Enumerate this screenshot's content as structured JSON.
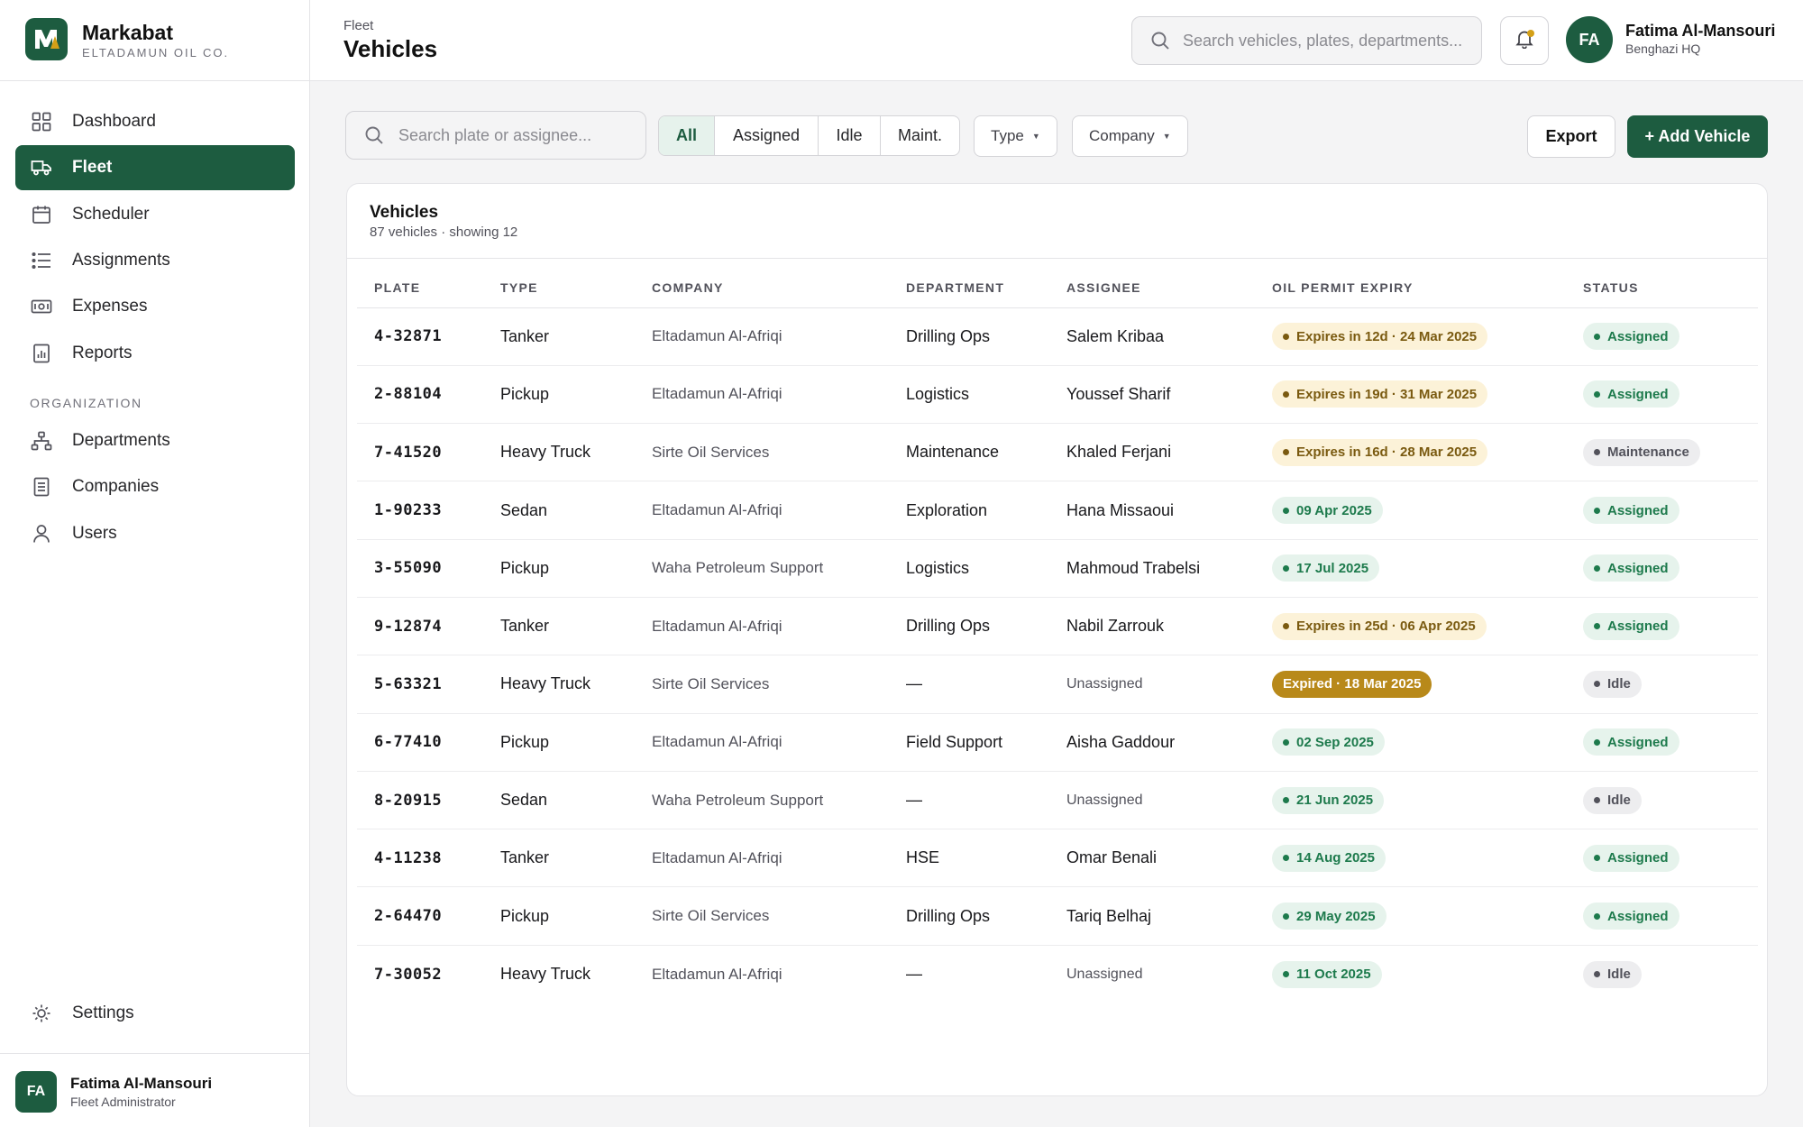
{
  "app": {
    "name": "Markabat",
    "subtitle": "ELTADAMUN OIL CO.",
    "logo_letter": "M"
  },
  "sidebar": {
    "items": [
      {
        "label": "Dashboard",
        "icon": "dashboard-grid-icon"
      },
      {
        "label": "Fleet",
        "icon": "truck-icon",
        "active": true
      },
      {
        "label": "Scheduler",
        "icon": "calendar-icon"
      },
      {
        "label": "Assignments",
        "icon": "list-icon"
      },
      {
        "label": "Expenses",
        "icon": "banknote-icon"
      },
      {
        "label": "Reports",
        "icon": "report-chart-icon"
      }
    ],
    "section_label": "ORGANIZATION",
    "org_items": [
      {
        "label": "Departments",
        "icon": "org-chart-icon"
      },
      {
        "label": "Companies",
        "icon": "document-icon"
      },
      {
        "label": "Users",
        "icon": "user-icon"
      }
    ],
    "settings_label": "Settings",
    "user": {
      "initials": "FA",
      "name": "Fatima Al-Mansouri",
      "role": "Fleet Administrator"
    }
  },
  "header": {
    "breadcrumb": "Fleet",
    "title": "Vehicles",
    "search_placeholder": "Search vehicles, plates, departments...",
    "user": {
      "initials": "FA",
      "name": "Fatima Al-Mansouri",
      "location": "Benghazi HQ"
    }
  },
  "toolbar": {
    "search_placeholder": "Search plate or assignee...",
    "filters": [
      {
        "label": "All",
        "active": true
      },
      {
        "label": "Assigned"
      },
      {
        "label": "Idle"
      },
      {
        "label": "Maint."
      }
    ],
    "type_dropdown": "Type",
    "company_dropdown": "Company",
    "export_label": "Export",
    "add_label": "+ Add Vehicle"
  },
  "table": {
    "title": "Vehicles",
    "subtitle": "87 vehicles · showing 12",
    "columns": [
      "PLATE",
      "TYPE",
      "COMPANY",
      "DEPARTMENT",
      "ASSIGNEE",
      "OIL PERMIT EXPIRY",
      "STATUS"
    ],
    "rows": [
      {
        "plate": "4-32871",
        "type": "Tanker",
        "company": "Eltadamun Al-Afriqi",
        "department": "Drilling Ops",
        "assignee": "Salem Kribaa",
        "expiry": "Expires in 12d · 24 Mar 2025",
        "expiry_state": "warn",
        "status": "Assigned"
      },
      {
        "plate": "2-88104",
        "type": "Pickup",
        "company": "Eltadamun Al-Afriqi",
        "department": "Logistics",
        "assignee": "Youssef Sharif",
        "expiry": "Expires in 19d · 31 Mar 2025",
        "expiry_state": "warn",
        "status": "Assigned"
      },
      {
        "plate": "7-41520",
        "type": "Heavy Truck",
        "company": "Sirte Oil Services",
        "department": "Maintenance",
        "assignee": "Khaled Ferjani",
        "expiry": "Expires in 16d · 28 Mar 2025",
        "expiry_state": "warn",
        "status": "Maintenance"
      },
      {
        "plate": "1-90233",
        "type": "Sedan",
        "company": "Eltadamun Al-Afriqi",
        "department": "Exploration",
        "assignee": "Hana Missaoui",
        "expiry": "09 Apr 2025",
        "expiry_state": "ok",
        "status": "Assigned"
      },
      {
        "plate": "3-55090",
        "type": "Pickup",
        "company": "Waha Petroleum Support",
        "department": "Logistics",
        "assignee": "Mahmoud Trabelsi",
        "expiry": "17 Jul 2025",
        "expiry_state": "ok",
        "status": "Assigned"
      },
      {
        "plate": "9-12874",
        "type": "Tanker",
        "company": "Eltadamun Al-Afriqi",
        "department": "Drilling Ops",
        "assignee": "Nabil Zarrouk",
        "expiry": "Expires in 25d · 06 Apr 2025",
        "expiry_state": "warn",
        "status": "Assigned"
      },
      {
        "plate": "5-63321",
        "type": "Heavy Truck",
        "company": "Sirte Oil Services",
        "department": "—",
        "assignee": "Unassigned",
        "expiry": "Expired · 18 Mar 2025",
        "expiry_state": "expired",
        "status": "Idle"
      },
      {
        "plate": "6-77410",
        "type": "Pickup",
        "company": "Eltadamun Al-Afriqi",
        "department": "Field Support",
        "assignee": "Aisha Gaddour",
        "expiry": "02 Sep 2025",
        "expiry_state": "ok",
        "status": "Assigned"
      },
      {
        "plate": "8-20915",
        "type": "Sedan",
        "company": "Waha Petroleum Support",
        "department": "—",
        "assignee": "Unassigned",
        "expiry": "21 Jun 2025",
        "expiry_state": "ok",
        "status": "Idle"
      },
      {
        "plate": "4-11238",
        "type": "Tanker",
        "company": "Eltadamun Al-Afriqi",
        "department": "HSE",
        "assignee": "Omar Benali",
        "expiry": "14 Aug 2025",
        "expiry_state": "ok",
        "status": "Assigned"
      },
      {
        "plate": "2-64470",
        "type": "Pickup",
        "company": "Sirte Oil Services",
        "department": "Drilling Ops",
        "assignee": "Tariq Belhaj",
        "expiry": "29 May 2025",
        "expiry_state": "ok",
        "status": "Assigned"
      },
      {
        "plate": "7-30052",
        "type": "Heavy Truck",
        "company": "Eltadamun Al-Afriqi",
        "department": "—",
        "assignee": "Unassigned",
        "expiry": "11 Oct 2025",
        "expiry_state": "ok",
        "status": "Idle"
      }
    ]
  },
  "colors": {
    "brand": "#1d5c40",
    "warning": "#7a5a10",
    "ok": "#1d7a4c",
    "expired": "#b8891a"
  }
}
